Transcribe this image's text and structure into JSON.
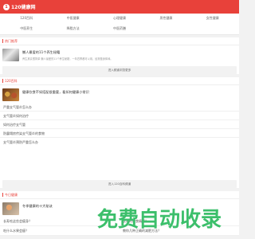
{
  "header": {
    "logo_glyph": "1",
    "title": "120健康网"
  },
  "nav": {
    "items": [
      "120百科",
      "中医健康",
      "心理健康",
      "男性健康",
      "女性健康",
      "中医养生",
      "降脂方法",
      "中医药膳"
    ]
  },
  "hot": {
    "title": "热门推荐",
    "feature_title": "懒人最爱的11个养生秘籍",
    "feature_desc": "养生其实很简单 懒人最爱的11个养生秘籍，一年四季都可以用，经常做身体棒。",
    "more": "进入频道浏览更多"
  },
  "baike": {
    "title": "120百科",
    "feature_title": "健康饮食不如搭配很重要，看如何健康小常识",
    "items": [
      "严重支气管炎怎么办",
      "支气管炎如何治疗",
      "如何治疗支气管",
      "防震塌房传染支气管炎的食物",
      "支气管炎预防严重怎么办"
    ],
    "more": "进入120百科频道"
  },
  "today": {
    "title": "今日健康",
    "feature_title": "冬季健康的十大秘诀",
    "pairs": [
      [
        "长寿吃这些会瘦身？",
        "长寿的饮食精要？"
      ],
      [
        "吃什么水果会瘦？",
        "教你几种正确的减肥方法？"
      ]
    ]
  },
  "watermark": {
    "text": "免费自动收录"
  },
  "colors": {
    "brand": "#e8413a",
    "watermark": "#3cbf6b"
  }
}
